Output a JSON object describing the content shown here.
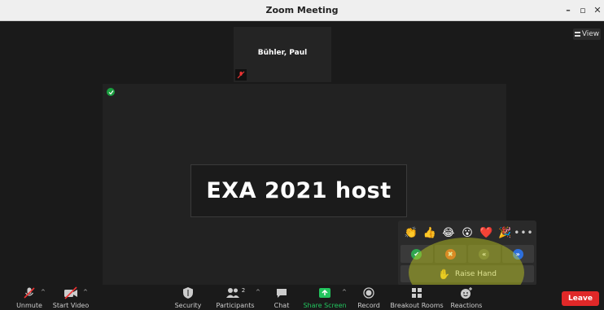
{
  "window": {
    "title": "Zoom Meeting",
    "minimize_glyph": "–",
    "maximize_glyph": "▫",
    "close_glyph": "✕"
  },
  "view_button": {
    "label": "View",
    "icon": "grid-icon"
  },
  "participant_thumb": {
    "name": "Bühler, Paul",
    "mic_icon": "mic-muted-icon"
  },
  "main_video": {
    "name": "EXA 2021 host",
    "security_icon": "shield-check-icon"
  },
  "reactions": {
    "emojis": [
      {
        "name": "clap-emoji",
        "glyph": "👏"
      },
      {
        "name": "thumbs-up-emoji",
        "glyph": "👍"
      },
      {
        "name": "joy-emoji",
        "glyph": "😂"
      },
      {
        "name": "open-mouth-emoji",
        "glyph": "😮"
      },
      {
        "name": "heart-emoji",
        "glyph": "❤️"
      },
      {
        "name": "party-emoji",
        "glyph": "🎉"
      }
    ],
    "more_glyph": "•••",
    "nonverbal": [
      {
        "name": "yes",
        "glyph": "✔",
        "color": "#2ea44f"
      },
      {
        "name": "no",
        "glyph": "✖",
        "color": "#e8502a"
      },
      {
        "name": "slower",
        "glyph": "«",
        "color": "#5a5f4a"
      },
      {
        "name": "faster",
        "glyph": "»",
        "color": "#2d6fdc"
      }
    ],
    "raise_hand": {
      "icon": "✋",
      "label": "Raise Hand"
    }
  },
  "toolbar": {
    "unmute": "Unmute",
    "start_video": "Start Video",
    "security": "Security",
    "participants": "Participants",
    "participants_count": "2",
    "chat": "Chat",
    "share_screen": "Share Screen",
    "record": "Record",
    "breakout_rooms": "Breakout Rooms",
    "reactions": "Reactions",
    "leave": "Leave"
  },
  "colors": {
    "share_green": "#22c55e",
    "leave_red": "#e02828",
    "highlight": "#c8d21e"
  }
}
